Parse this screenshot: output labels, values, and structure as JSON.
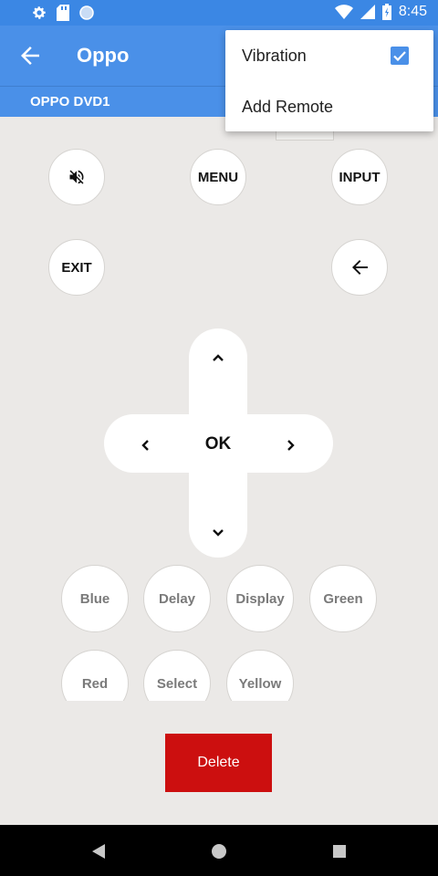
{
  "status_bar": {
    "time": "8:45",
    "left_icons": [
      "gear-icon",
      "sd-card-icon",
      "circle-icon"
    ],
    "right_icons": [
      "wifi-icon",
      "signal-icon",
      "battery-icon"
    ]
  },
  "app_bar": {
    "title": "Oppo",
    "subtitle": "OPPO DVD1",
    "back_icon": "arrow-left-icon"
  },
  "popup_menu": {
    "items": [
      {
        "label": "Vibration",
        "checked": true
      },
      {
        "label": "Add Remote"
      }
    ]
  },
  "remote": {
    "mute_icon": "mute-icon",
    "menu_label": "MENU",
    "input_label": "INPUT",
    "exit_label": "EXIT",
    "back_icon": "arrow-left-icon",
    "dpad": {
      "ok_label": "OK",
      "up_icon": "chevron-up-icon",
      "down_icon": "chevron-down-icon",
      "left_icon": "chevron-left-icon",
      "right_icon": "chevron-right-icon"
    },
    "color_buttons": [
      "Blue",
      "Delay",
      "Display",
      "Green"
    ],
    "second_row_buttons": [
      "Red",
      "Select",
      "Yellow"
    ],
    "delete_label": "Delete"
  },
  "nav_bar": {
    "icons": [
      "back-triangle-icon",
      "home-circle-icon",
      "recents-square-icon"
    ]
  },
  "colors": {
    "app_bar": "#4a90e8",
    "status_bar": "#3b87e4",
    "delete": "#cc0f0f",
    "background": "#ebe9e7"
  }
}
